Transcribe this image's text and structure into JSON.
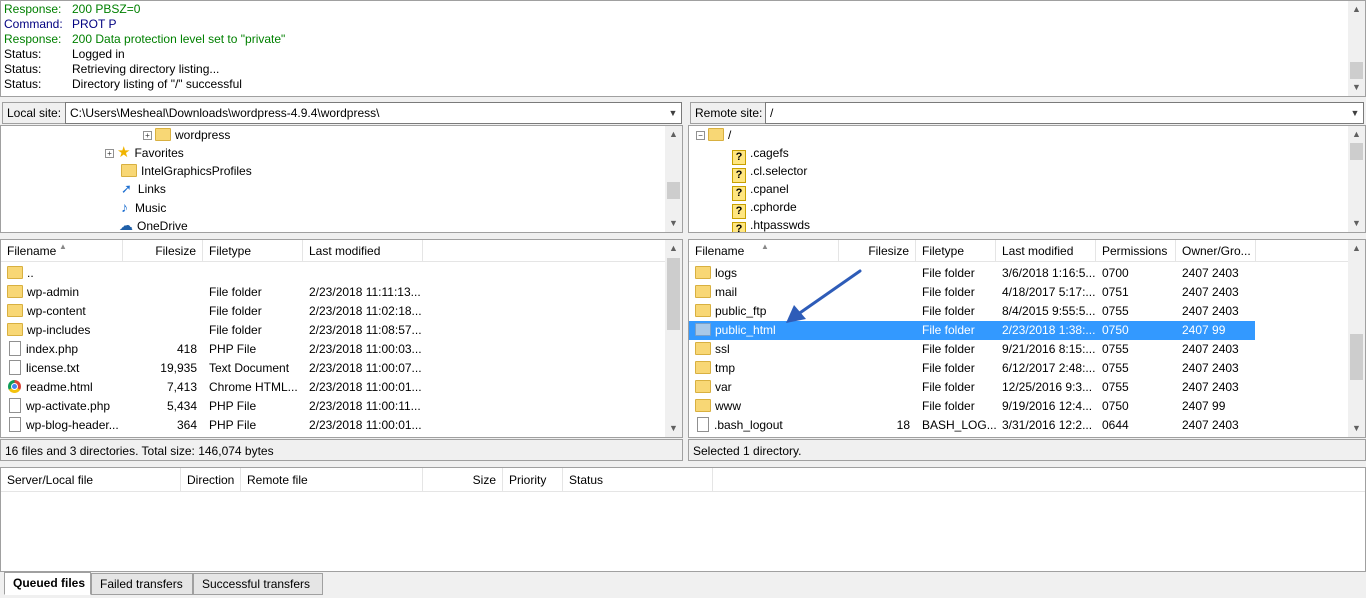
{
  "log": [
    {
      "key": "Response:",
      "value": "200 PBSZ=0",
      "color": "#008000"
    },
    {
      "key": "Command:",
      "value": "PROT P",
      "color": "#000080"
    },
    {
      "key": "Response:",
      "value": "200 Data protection level set to \"private\"",
      "color": "#008000"
    },
    {
      "key": "Status:",
      "value": "Logged in",
      "color": "#000000"
    },
    {
      "key": "Status:",
      "value": "Retrieving directory listing...",
      "color": "#000000"
    },
    {
      "key": "Status:",
      "value": "Directory listing of \"/\" successful",
      "color": "#000000"
    }
  ],
  "local": {
    "label": "Local site:",
    "path": "C:\\Users\\Mesheal\\Downloads\\wordpress-4.9.4\\wordpress\\",
    "tree": [
      {
        "name": "wordpress",
        "icon": "folder-icon",
        "expander": "+"
      },
      {
        "name": "Favorites",
        "icon": "star-icon",
        "expander": "+"
      },
      {
        "name": "IntelGraphicsProfiles",
        "icon": "folder-icon",
        "expander": ""
      },
      {
        "name": "Links",
        "icon": "links-icon",
        "expander": ""
      },
      {
        "name": "Music",
        "icon": "music-icon",
        "expander": ""
      },
      {
        "name": "OneDrive",
        "icon": "onedrive-icon",
        "expander": ""
      }
    ],
    "columns": [
      "Filename",
      "Filesize",
      "Filetype",
      "Last modified"
    ],
    "files": [
      {
        "name": "..",
        "size": "",
        "type": "",
        "modified": "",
        "icon": "folder-icon"
      },
      {
        "name": "wp-admin",
        "size": "",
        "type": "File folder",
        "modified": "2/23/2018 11:11:13...",
        "icon": "folder-icon"
      },
      {
        "name": "wp-content",
        "size": "",
        "type": "File folder",
        "modified": "2/23/2018 11:02:18...",
        "icon": "folder-icon"
      },
      {
        "name": "wp-includes",
        "size": "",
        "type": "File folder",
        "modified": "2/23/2018 11:08:57...",
        "icon": "folder-icon"
      },
      {
        "name": "index.php",
        "size": "418",
        "type": "PHP File",
        "modified": "2/23/2018 11:00:03...",
        "icon": "file-icon"
      },
      {
        "name": "license.txt",
        "size": "19,935",
        "type": "Text Document",
        "modified": "2/23/2018 11:00:07...",
        "icon": "file-icon"
      },
      {
        "name": "readme.html",
        "size": "7,413",
        "type": "Chrome HTML...",
        "modified": "2/23/2018 11:00:01...",
        "icon": "chrome-icon"
      },
      {
        "name": "wp-activate.php",
        "size": "5,434",
        "type": "PHP File",
        "modified": "2/23/2018 11:00:11...",
        "icon": "file-icon"
      },
      {
        "name": "wp-blog-header...",
        "size": "364",
        "type": "PHP File",
        "modified": "2/23/2018 11:00:01...",
        "icon": "file-icon"
      }
    ],
    "status": "16 files and 3 directories. Total size: 146,074 bytes"
  },
  "remote": {
    "label": "Remote site:",
    "path": "/",
    "tree": [
      {
        "name": "/",
        "icon": "folder-icon",
        "expander": "−"
      },
      {
        "name": ".cagefs",
        "icon": "question-icon"
      },
      {
        "name": ".cl.selector",
        "icon": "question-icon"
      },
      {
        "name": ".cpanel",
        "icon": "question-icon"
      },
      {
        "name": ".cphorde",
        "icon": "question-icon"
      },
      {
        "name": ".htpasswds",
        "icon": "question-icon"
      }
    ],
    "columns": [
      "Filename",
      "Filesize",
      "Filetype",
      "Last modified",
      "Permissions",
      "Owner/Gro..."
    ],
    "files": [
      {
        "name": "logs",
        "size": "",
        "type": "File folder",
        "modified": "3/6/2018 1:16:5...",
        "perm": "0700",
        "owner": "2407 2403",
        "icon": "folder-icon"
      },
      {
        "name": "mail",
        "size": "",
        "type": "File folder",
        "modified": "4/18/2017 5:17:...",
        "perm": "0751",
        "owner": "2407 2403",
        "icon": "folder-icon"
      },
      {
        "name": "public_ftp",
        "size": "",
        "type": "File folder",
        "modified": "8/4/2015 9:55:5...",
        "perm": "0755",
        "owner": "2407 2403",
        "icon": "folder-icon"
      },
      {
        "name": "public_html",
        "size": "",
        "type": "File folder",
        "modified": "2/23/2018 1:38:...",
        "perm": "0750",
        "owner": "2407 99",
        "icon": "folder-icon",
        "selected": true
      },
      {
        "name": "ssl",
        "size": "",
        "type": "File folder",
        "modified": "9/21/2016 8:15:...",
        "perm": "0755",
        "owner": "2407 2403",
        "icon": "folder-icon"
      },
      {
        "name": "tmp",
        "size": "",
        "type": "File folder",
        "modified": "6/12/2017 2:48:...",
        "perm": "0755",
        "owner": "2407 2403",
        "icon": "folder-icon"
      },
      {
        "name": "var",
        "size": "",
        "type": "File folder",
        "modified": "12/25/2016 9:3...",
        "perm": "0755",
        "owner": "2407 2403",
        "icon": "folder-icon"
      },
      {
        "name": "www",
        "size": "",
        "type": "File folder",
        "modified": "9/19/2016 12:4...",
        "perm": "0750",
        "owner": "2407 99",
        "icon": "folder-icon"
      },
      {
        "name": ".bash_logout",
        "size": "18",
        "type": "BASH_LOG...",
        "modified": "3/31/2016 12:2...",
        "perm": "0644",
        "owner": "2407 2403",
        "icon": "file-icon"
      }
    ],
    "status": "Selected 1 directory."
  },
  "queue": {
    "columns": [
      "Server/Local file",
      "Direction",
      "Remote file",
      "Size",
      "Priority",
      "Status"
    ],
    "tabs": [
      "Queued files",
      "Failed transfers",
      "Successful transfers"
    ]
  },
  "colors": {
    "selection": "#3399ff",
    "annotation_arrow": "#2e5cb8"
  }
}
